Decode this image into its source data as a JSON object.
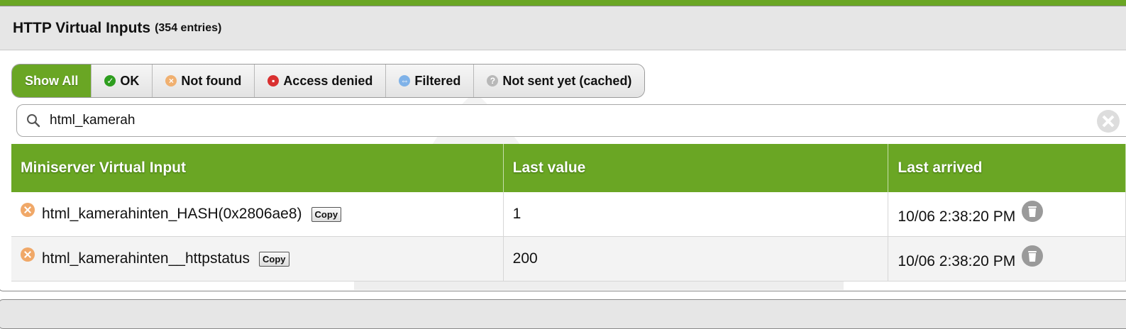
{
  "header": {
    "title": "HTTP Virtual Inputs",
    "count": "(354 entries)"
  },
  "filters": [
    {
      "label": "Show All",
      "icon": "none",
      "active": true
    },
    {
      "label": "OK",
      "icon": "check-circle-icon",
      "color": "#2e9e1f"
    },
    {
      "label": "Not found",
      "icon": "x-circle-icon",
      "color": "#f0b070"
    },
    {
      "label": "Access denied",
      "icon": "lock-icon",
      "color": "#d93030"
    },
    {
      "label": "Filtered",
      "icon": "filter-icon",
      "color": "#7fb2e8"
    },
    {
      "label": "Not sent yet (cached)",
      "icon": "question-circle-icon",
      "color": "#b8b8b8"
    }
  ],
  "search": {
    "value": "html_kamerah"
  },
  "table": {
    "columns": [
      "Miniserver Virtual Input",
      "Last value",
      "Last arrived"
    ],
    "copy_label": "Copy",
    "rows": [
      {
        "name": "html_kamerahinten_HASH(0x2806ae8)",
        "value": "1",
        "arrived": "10/06 2:38:20 PM"
      },
      {
        "name": "html_kamerahinten__httpstatus",
        "value": "200",
        "arrived": "10/06 2:38:20 PM"
      }
    ]
  },
  "colors": {
    "accent": "#6aa624",
    "header_bg": "#e6e6e6",
    "status_not_found": "#f0a868"
  }
}
